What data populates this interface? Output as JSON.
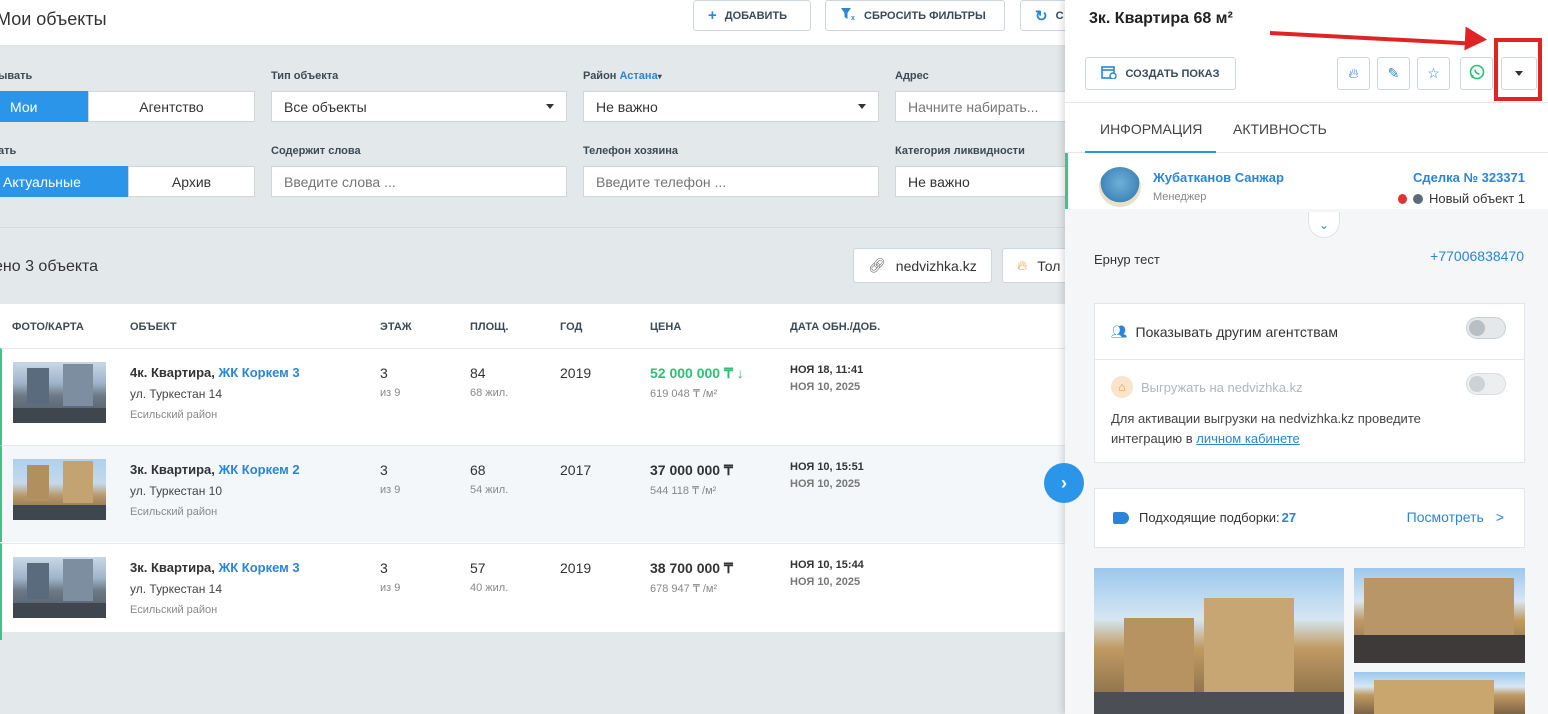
{
  "header": {
    "title": "Мои объекты",
    "add_button": "ДОБАВИТЬ",
    "reset_filters_button": "СБРОСИТЬ ФИЛЬТРЫ",
    "third_button": "С"
  },
  "filters": {
    "show_label": "ывать",
    "show_options": [
      "Мои",
      "Агентство"
    ],
    "type_label": "Тип объекта",
    "type_value": "Все объекты",
    "district_label": "Район",
    "district_city": "Астана",
    "district_value": "Не важно",
    "address_label": "Адрес",
    "address_placeholder": "Начните набирать...",
    "status_label": "ать",
    "status_options": [
      "Актуальные",
      "Архив"
    ],
    "words_label": "Содержит слова",
    "words_placeholder": "Введите слова ...",
    "phone_label": "Телефон хозяина",
    "phone_placeholder": "Введите телефон ...",
    "liquidity_label": "Категория ликвидности",
    "liquidity_value": "Не важно"
  },
  "results": {
    "count_text": "ено 3 объекта",
    "site_button": "nedvizhka.kz",
    "hot_button": "Тол"
  },
  "table": {
    "headers": [
      "ФОТО/КАРТА",
      "ОБЪЕКТ",
      "ЭТАЖ",
      "ПЛОЩ.",
      "ГОД",
      "ЦЕНА",
      "ДАТА ОБН./ДОБ."
    ],
    "rows": [
      {
        "type": "4к. Квартира, ",
        "complex": "ЖК Коркем 3",
        "street": "ул. Туркестан 14",
        "district": "Есильский район",
        "floor": "3",
        "floors_total": "из 9",
        "area": "84",
        "living": "68 жил.",
        "year": "2019",
        "price": "52 000 000 ₸",
        "price_change": "↓",
        "per_m": "619 048 ₸ /м²",
        "updated": "НОЯ 18, 11:41",
        "added": "НОЯ 10, 2025"
      },
      {
        "type": "3к. Квартира, ",
        "complex": "ЖК Коркем 2",
        "street": "ул. Туркестан 10",
        "district": "Есильский район",
        "floor": "3",
        "floors_total": "из 9",
        "area": "68",
        "living": "54 жил.",
        "year": "2017",
        "price": "37 000 000 ₸",
        "price_change": "",
        "per_m": "544 118 ₸ /м²",
        "updated": "НОЯ 10, 15:51",
        "added": "НОЯ 10, 2025"
      },
      {
        "type": "3к. Квартира, ",
        "complex": "ЖК Коркем 3",
        "street": "ул. Туркестан 14",
        "district": "Есильский район",
        "floor": "3",
        "floors_total": "из 9",
        "area": "57",
        "living": "40 жил.",
        "year": "2019",
        "price": "38 700 000 ₸",
        "price_change": "",
        "per_m": "678 947 ₸ /м²",
        "updated": "НОЯ 10, 15:44",
        "added": "НОЯ 10, 2025"
      }
    ]
  },
  "panel": {
    "title": "3к. Квартира 68 м²",
    "create_show": "СОЗДАТЬ ПОКАЗ",
    "tabs": [
      "ИНФОРМАЦИЯ",
      "АКТИВНОСТЬ"
    ],
    "manager_name": "Жубатканов Санжар",
    "manager_role": "Менеджер",
    "deal": "Сделка № 323371",
    "deal_status": "Новый объект 1",
    "client_name": "Ернур тест",
    "client_phone": "+77006838470",
    "show_agencies": "Показывать другим агентствам",
    "export_label": "Выгружать на nedvizhka.kz",
    "export_note_1": "Для активации выгрузки на nedvizhka.kz проведите",
    "export_note_2": "интеграцию в ",
    "export_note_link": "личном кабинете",
    "selections_label": "Подходящие подборки: ",
    "selections_count": "27",
    "selections_link": "Посмотреть",
    "selections_chevron": ">",
    "expand_icon": "›"
  },
  "colors": {
    "accent": "#2b95e9",
    "green": "#2fbf71",
    "highlight": "#e02424"
  }
}
